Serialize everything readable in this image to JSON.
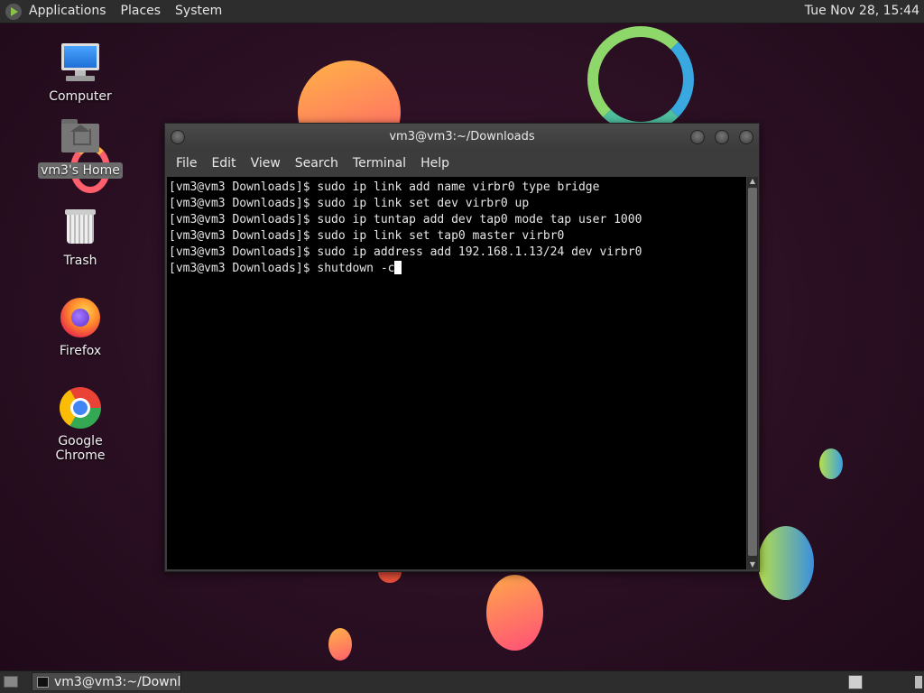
{
  "top_panel": {
    "menus": [
      "Applications",
      "Places",
      "System"
    ],
    "clock": "Tue Nov 28, 15:44"
  },
  "desktop": {
    "icons": [
      {
        "label": "Computer",
        "icon": "computer-icon"
      },
      {
        "label": "vm3's Home",
        "icon": "home-folder-icon",
        "selected": true
      },
      {
        "label": "Trash",
        "icon": "trash-icon"
      },
      {
        "label": "Firefox",
        "icon": "firefox-icon"
      },
      {
        "label": "Google Chrome",
        "icon": "chrome-icon"
      }
    ]
  },
  "terminal": {
    "title": "vm3@vm3:~/Downloads",
    "menu": [
      "File",
      "Edit",
      "View",
      "Search",
      "Terminal",
      "Help"
    ],
    "prompt": "[vm3@vm3 Downloads]$ ",
    "lines": [
      "sudo ip link add name virbr0 type bridge",
      "sudo ip link set dev virbr0 up",
      "sudo ip tuntap add dev tap0 mode tap user 1000",
      "sudo ip link set tap0 master virbr0",
      "sudo ip address add 192.168.1.13/24 dev virbr0"
    ],
    "current_input": "shutdown -c"
  },
  "taskbar": {
    "window_button": "vm3@vm3:~/Downl..."
  }
}
